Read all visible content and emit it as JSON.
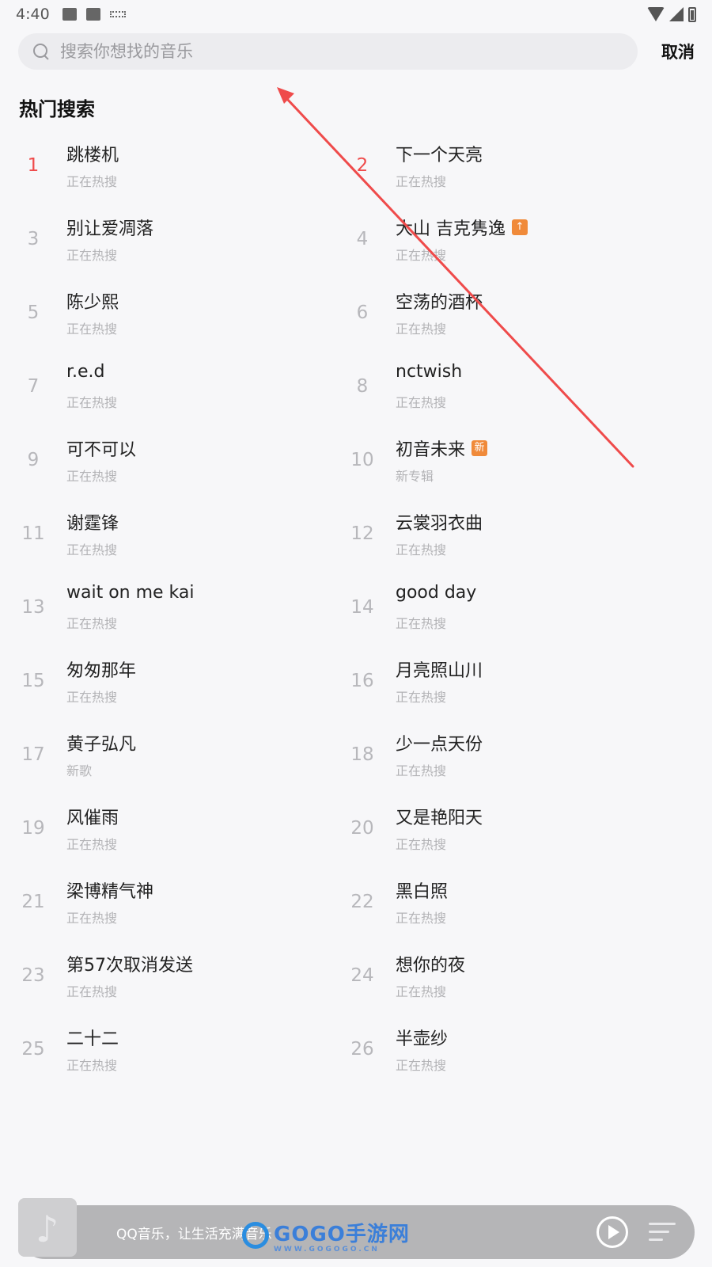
{
  "status_bar": {
    "time": "4:40"
  },
  "search": {
    "placeholder": "搜索你想找的音乐",
    "cancel_label": "取消"
  },
  "section": {
    "title": "热门搜索"
  },
  "hot_items": [
    {
      "rank": "1",
      "title": "跳楼机",
      "sub": "正在热搜",
      "badge": ""
    },
    {
      "rank": "2",
      "title": "下一个天亮",
      "sub": "正在热搜",
      "badge": ""
    },
    {
      "rank": "3",
      "title": "别让爱凋落",
      "sub": "正在热搜",
      "badge": ""
    },
    {
      "rank": "4",
      "title": "大山 吉克隽逸",
      "sub": "正在热搜",
      "badge": "up"
    },
    {
      "rank": "5",
      "title": "陈少熙",
      "sub": "正在热搜",
      "badge": ""
    },
    {
      "rank": "6",
      "title": "空荡的酒杯",
      "sub": "正在热搜",
      "badge": ""
    },
    {
      "rank": "7",
      "title": "r.e.d",
      "sub": "正在热搜",
      "badge": ""
    },
    {
      "rank": "8",
      "title": "nctwish",
      "sub": "正在热搜",
      "badge": ""
    },
    {
      "rank": "9",
      "title": "可不可以",
      "sub": "正在热搜",
      "badge": ""
    },
    {
      "rank": "10",
      "title": "初音未来",
      "sub": "新专辑",
      "badge": "新"
    },
    {
      "rank": "11",
      "title": "谢霆锋",
      "sub": "正在热搜",
      "badge": ""
    },
    {
      "rank": "12",
      "title": "云裳羽衣曲",
      "sub": "正在热搜",
      "badge": ""
    },
    {
      "rank": "13",
      "title": "wait on me kai",
      "sub": "正在热搜",
      "badge": ""
    },
    {
      "rank": "14",
      "title": "good day",
      "sub": "正在热搜",
      "badge": ""
    },
    {
      "rank": "15",
      "title": "匆匆那年",
      "sub": "正在热搜",
      "badge": ""
    },
    {
      "rank": "16",
      "title": "月亮照山川",
      "sub": "正在热搜",
      "badge": ""
    },
    {
      "rank": "17",
      "title": "黄子弘凡",
      "sub": "新歌",
      "badge": ""
    },
    {
      "rank": "18",
      "title": "少一点天份",
      "sub": "正在热搜",
      "badge": ""
    },
    {
      "rank": "19",
      "title": "风催雨",
      "sub": "正在热搜",
      "badge": ""
    },
    {
      "rank": "20",
      "title": "又是艳阳天",
      "sub": "正在热搜",
      "badge": ""
    },
    {
      "rank": "21",
      "title": "梁博精气神",
      "sub": "正在热搜",
      "badge": ""
    },
    {
      "rank": "22",
      "title": "黑白照",
      "sub": "正在热搜",
      "badge": ""
    },
    {
      "rank": "23",
      "title": "第57次取消发送",
      "sub": "正在热搜",
      "badge": ""
    },
    {
      "rank": "24",
      "title": "想你的夜",
      "sub": "正在热搜",
      "badge": ""
    },
    {
      "rank": "25",
      "title": "二十二",
      "sub": "正在热搜",
      "badge": ""
    },
    {
      "rank": "26",
      "title": "半壶纱",
      "sub": "正在热搜",
      "badge": ""
    }
  ],
  "player": {
    "text": "QQ音乐，让生活充满音乐"
  },
  "watermark": {
    "text": "GOGO手游网",
    "sub": "WWW.GOGOGO.CN"
  },
  "colors": {
    "rank_top": "#ef4b4b",
    "rank_default": "#b7b7bb",
    "badge": "#f08a3a",
    "annotation_arrow": "#ef4b4b"
  }
}
